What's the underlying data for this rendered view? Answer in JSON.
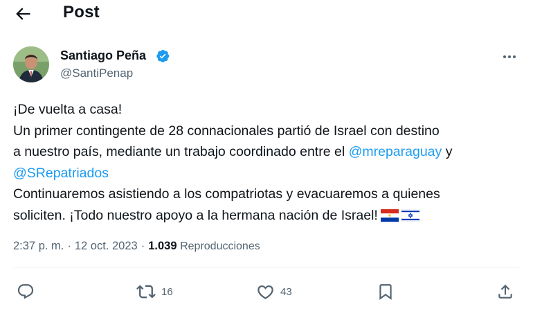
{
  "header": {
    "title": "Post"
  },
  "author": {
    "name": "Santiago Peña",
    "handle": "@SantiPenap"
  },
  "tweet": {
    "line1": "¡De vuelta a casa!",
    "line2": "Un primer contingente de 28 connacionales partió de Israel con destino",
    "line3_text": "a nuestro país, mediante un trabajo coordinado entre el ",
    "mention1": "@mreparaguay",
    "line3_after": " y",
    "mention2": "@SRepatriados",
    "line5": "Continuaremos asistiendo a los compatriotas y evacuaremos a quienes",
    "line6": "soliciten. ¡Todo nuestro apoyo a la hermana nación de Israel!",
    "flags": [
      "paraguay-flag",
      "israel-flag"
    ]
  },
  "meta": {
    "time": "2:37 p. m.",
    "separator": "·",
    "date": "12 oct. 2023",
    "views_count": "1.039",
    "views_label": "Reproducciones"
  },
  "actions": {
    "reply": {
      "icon": "reply-icon"
    },
    "retweet": {
      "icon": "retweet-icon",
      "count": "16"
    },
    "like": {
      "icon": "heart-icon",
      "count": "43"
    },
    "bookmark": {
      "icon": "bookmark-icon"
    },
    "share": {
      "icon": "share-icon"
    }
  },
  "colors": {
    "accent": "#1d9bf0",
    "text": "#0f1419",
    "secondary": "#536471"
  }
}
